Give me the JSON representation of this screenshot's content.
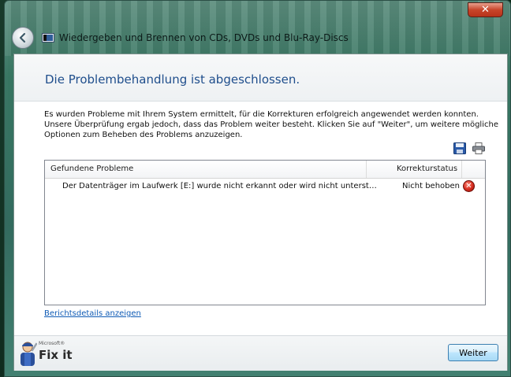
{
  "window": {
    "title": "Wiedergeben und Brennen von CDs, DVDs und Blu-Ray-Discs",
    "close_label": "✕"
  },
  "main": {
    "heading": "Die Problembehandlung ist abgeschlossen.",
    "description": [
      "Es wurden Probleme mit Ihrem System ermittelt, für die Korrekturen erfolgreich angewendet werden konnten.",
      "Unsere Überprüfung ergab jedoch, dass das Problem weiter besteht. Klicken Sie auf \"Weiter\", um weitere mögliche",
      "Optionen zum Beheben des Problems anzuzeigen."
    ],
    "table": {
      "headers": [
        "Gefundene Probleme",
        "Korrekturstatus"
      ],
      "rows": [
        {
          "problem": "Der Datenträger im Laufwerk [E:] wurde nicht erkannt oder wird nicht unterst…",
          "status": "Nicht behoben",
          "status_icon": "error-icon"
        }
      ]
    },
    "details_link": "Berichtsdetails anzeigen"
  },
  "footer": {
    "logo_small": "Microsoft®",
    "logo_big": "Fix it",
    "next_label": "Weiter"
  },
  "icons": {
    "back": "back-arrow-icon",
    "app": "media-app-icon",
    "save": "save-icon",
    "print": "print-icon"
  },
  "colors": {
    "heading": "#1f4e8c",
    "link": "#0f5bb5",
    "error": "#d52b1e",
    "close": "#c7452a"
  }
}
